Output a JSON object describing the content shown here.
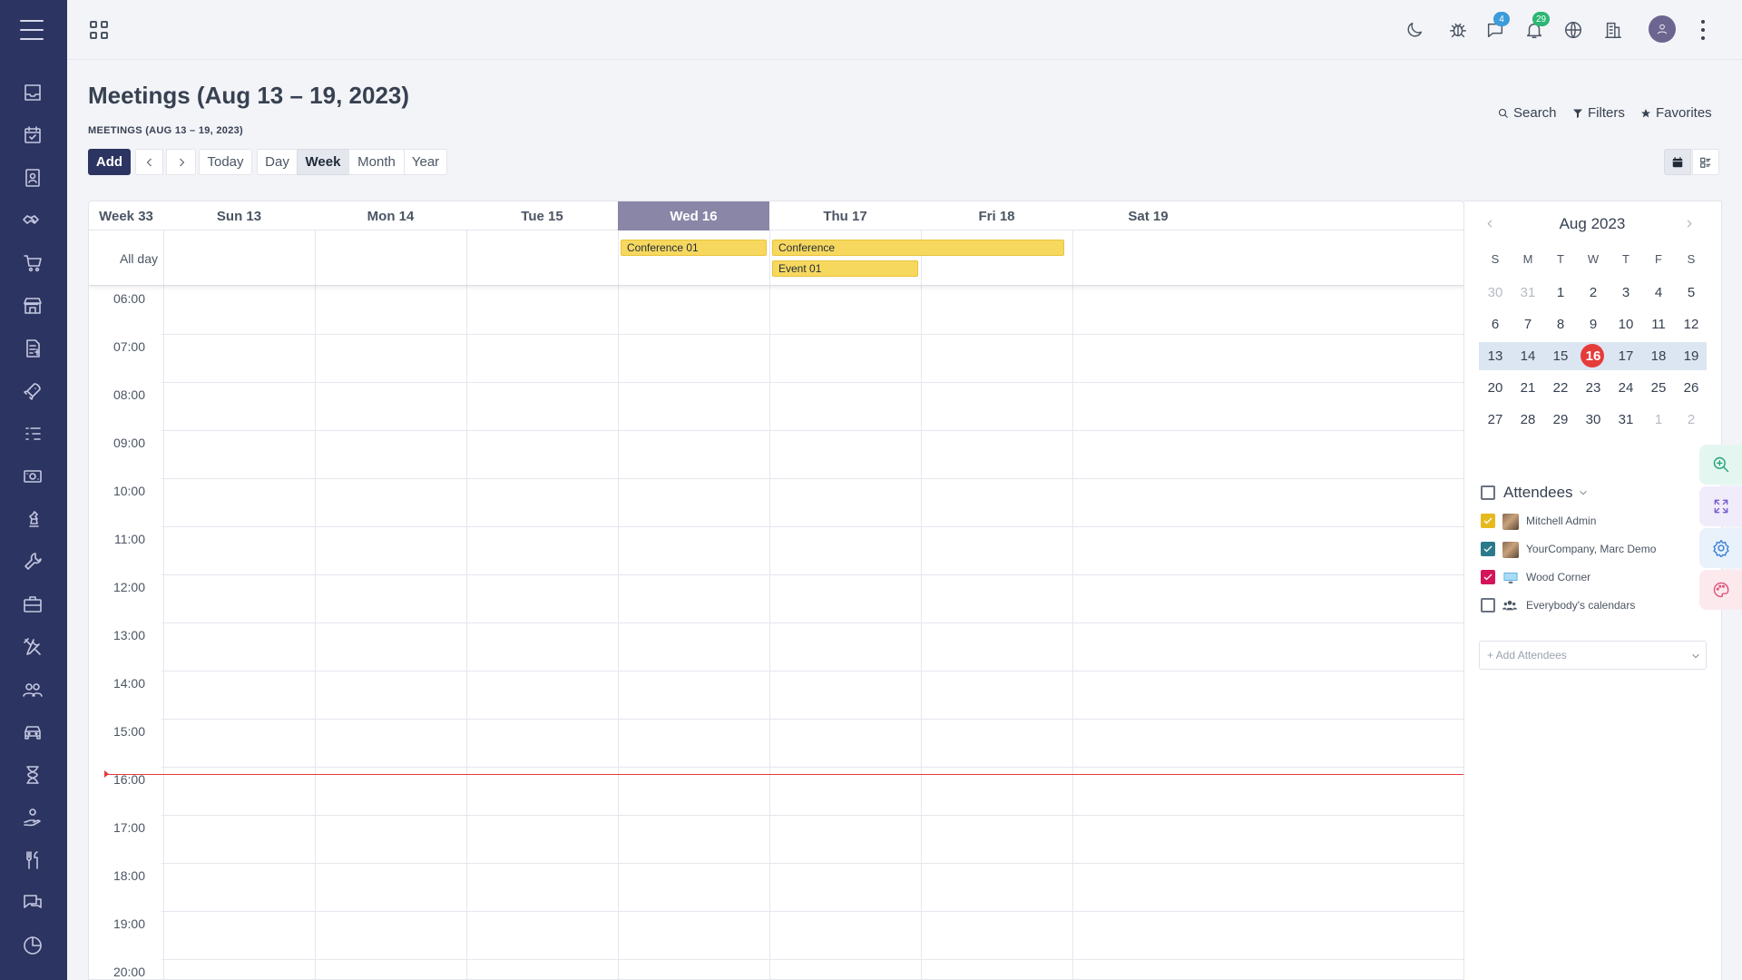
{
  "sidebar": {
    "items": [
      {
        "icon": "inbox-icon"
      },
      {
        "icon": "calendar-check-icon"
      },
      {
        "icon": "contacts-icon"
      },
      {
        "icon": "handshake-icon"
      },
      {
        "icon": "cart-icon"
      },
      {
        "icon": "store-icon"
      },
      {
        "icon": "invoice-icon"
      },
      {
        "icon": "rocket-icon"
      },
      {
        "icon": "list-icon"
      },
      {
        "icon": "money-icon"
      },
      {
        "icon": "chess-icon"
      },
      {
        "icon": "wrench-icon"
      },
      {
        "icon": "briefcase-icon"
      },
      {
        "icon": "tools-icon"
      },
      {
        "icon": "people-icon"
      },
      {
        "icon": "car-icon"
      },
      {
        "icon": "hourglass-icon"
      },
      {
        "icon": "hand-coin-icon"
      },
      {
        "icon": "utensils-icon"
      },
      {
        "icon": "chat-icon"
      },
      {
        "icon": "pie-icon"
      }
    ]
  },
  "topbar": {
    "messages_badge": "4",
    "notifications_badge": "29",
    "badge_colors": {
      "messages": "#3b9cd9",
      "notifications": "#2bb673"
    }
  },
  "header": {
    "title": "Meetings (Aug 13 – 19, 2023)",
    "breadcrumb": "MEETINGS (AUG 13 – 19, 2023)",
    "search_label": "Search",
    "filters_label": "Filters",
    "favorites_label": "Favorites"
  },
  "toolbar": {
    "add_label": "Add",
    "today_label": "Today",
    "scales": [
      "Day",
      "Week",
      "Month",
      "Year"
    ],
    "active_scale": "Week"
  },
  "calendar": {
    "week_label": "Week 33",
    "days": [
      "Sun 13",
      "Mon 14",
      "Tue 15",
      "Wed 16",
      "Thu 17",
      "Fri 18",
      "Sat 19"
    ],
    "today_day": "Wed 16",
    "allday_label": "All day",
    "allday_events": [
      {
        "title": "Conference 01",
        "start_day": "Wed 16",
        "end_day": "Wed 16",
        "row": 0
      },
      {
        "title": "Conference",
        "start_day": "Thu 17",
        "end_day": "Fri 18",
        "row": 0
      },
      {
        "title": "Event 01",
        "start_day": "Thu 17",
        "end_day": "Thu 17",
        "row": 1
      }
    ],
    "hours": [
      "06:00",
      "07:00",
      "08:00",
      "09:00",
      "10:00",
      "11:00",
      "12:00",
      "13:00",
      "14:00",
      "15:00",
      "16:00",
      "17:00",
      "18:00",
      "19:00",
      "20:00"
    ],
    "event_color": "#f7d85f",
    "today_color": "#8a86a8",
    "now_color": "#e33b3b"
  },
  "mini_calendar": {
    "title": "Aug 2023",
    "weekdays": [
      "S",
      "M",
      "T",
      "W",
      "T",
      "F",
      "S"
    ],
    "weeks": [
      [
        {
          "d": "30",
          "m": true
        },
        {
          "d": "31",
          "m": true
        },
        {
          "d": "1"
        },
        {
          "d": "2"
        },
        {
          "d": "3"
        },
        {
          "d": "4"
        },
        {
          "d": "5"
        }
      ],
      [
        {
          "d": "6"
        },
        {
          "d": "7"
        },
        {
          "d": "8"
        },
        {
          "d": "9"
        },
        {
          "d": "10"
        },
        {
          "d": "11"
        },
        {
          "d": "12"
        }
      ],
      [
        {
          "d": "13"
        },
        {
          "d": "14"
        },
        {
          "d": "15"
        },
        {
          "d": "16",
          "today": true
        },
        {
          "d": "17"
        },
        {
          "d": "18"
        },
        {
          "d": "19"
        }
      ],
      [
        {
          "d": "20"
        },
        {
          "d": "21"
        },
        {
          "d": "22"
        },
        {
          "d": "23"
        },
        {
          "d": "24"
        },
        {
          "d": "25"
        },
        {
          "d": "26"
        }
      ],
      [
        {
          "d": "27"
        },
        {
          "d": "28"
        },
        {
          "d": "29"
        },
        {
          "d": "30"
        },
        {
          "d": "31"
        },
        {
          "d": "1",
          "m": true
        },
        {
          "d": "2",
          "m": true
        }
      ]
    ]
  },
  "attendees": {
    "title": "Attendees",
    "items": [
      {
        "name": "Mitchell Admin",
        "checked": true,
        "color": "#e6b91e",
        "avatar": "photo"
      },
      {
        "name": "YourCompany, Marc Demo",
        "checked": true,
        "color": "#2b7a8c",
        "avatar": "photo"
      },
      {
        "name": "Wood Corner",
        "checked": true,
        "color": "#d4145a",
        "avatar": "computer"
      },
      {
        "name": "Everybody's calendars",
        "checked": false,
        "color": "#6b7280",
        "avatar": "group"
      }
    ],
    "add_placeholder": "+ Add Attendees"
  }
}
